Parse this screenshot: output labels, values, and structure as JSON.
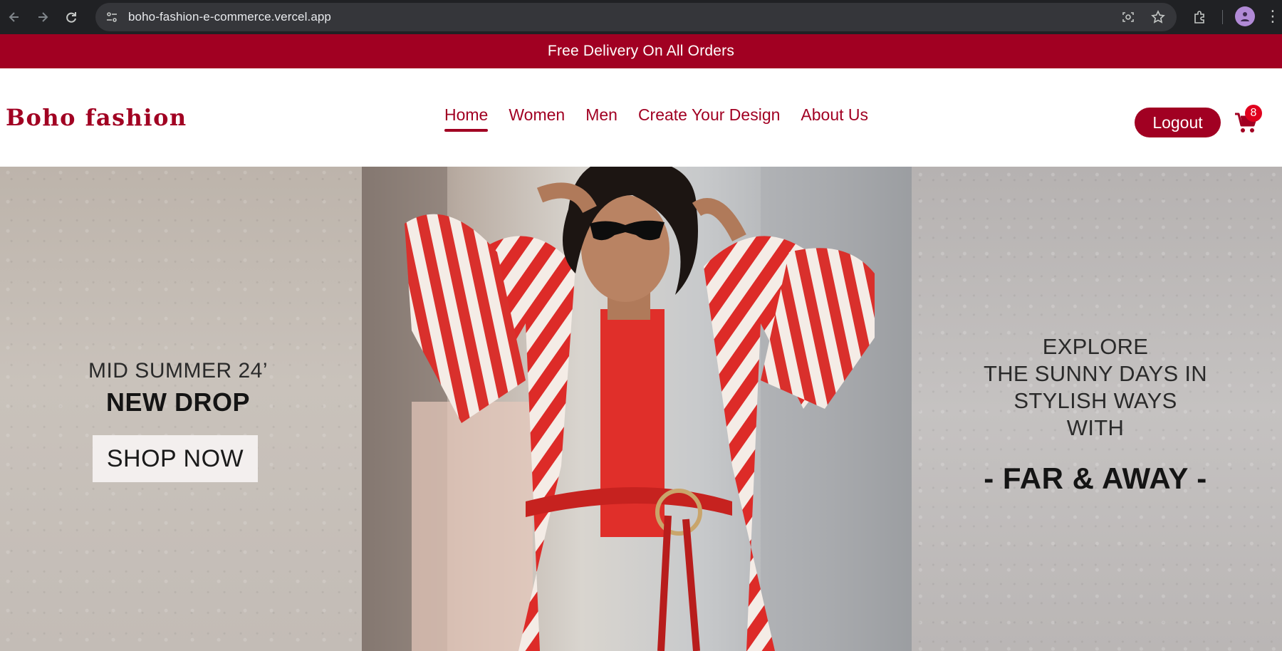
{
  "browser": {
    "url": "boho-fashion-e-commerce.vercel.app",
    "icons": [
      "back-icon",
      "forward-icon",
      "reload-icon",
      "site-info-icon",
      "lens-icon",
      "bookmark-star-icon",
      "extensions-icon",
      "profile-avatar",
      "more-menu-icon"
    ]
  },
  "announcement": {
    "text": "Free Delivery On All Orders"
  },
  "header": {
    "logo": "Boho fashion",
    "nav": [
      {
        "label": "Home",
        "active": true
      },
      {
        "label": "Women",
        "active": false
      },
      {
        "label": "Men",
        "active": false
      },
      {
        "label": "Create Your Design",
        "active": false
      },
      {
        "label": "About Us",
        "active": false
      }
    ],
    "logout_label": "Logout",
    "cart_count": "8"
  },
  "hero": {
    "left": {
      "subtitle": "MID SUMMER 24’",
      "title": "NEW DROP",
      "cta": "SHOP NOW"
    },
    "right": {
      "lines": [
        "EXPLORE",
        "THE SUNNY DAYS IN",
        "STYLISH WAYS",
        "WITH"
      ],
      "brand": "- FAR & AWAY -"
    }
  },
  "colors": {
    "brand": "#a10022",
    "badge": "#e0001e",
    "chrome": "#202124"
  }
}
